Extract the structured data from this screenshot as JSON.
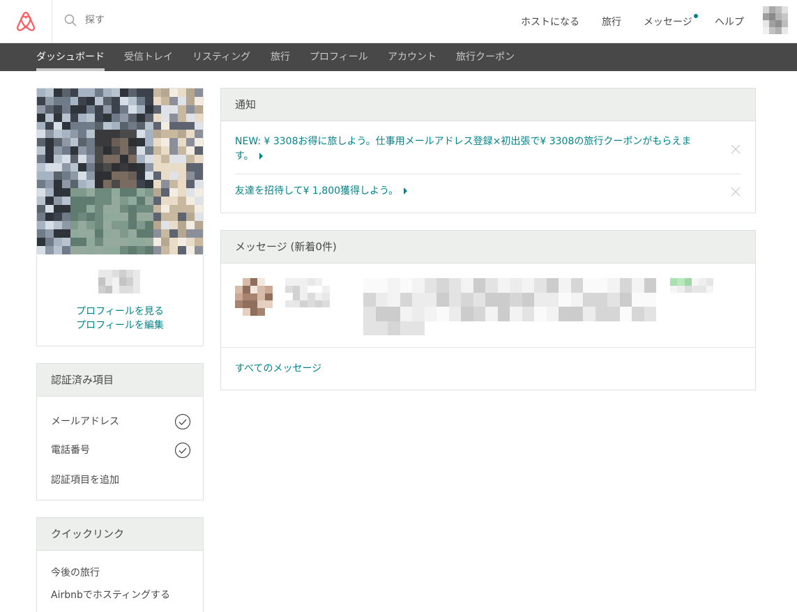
{
  "header": {
    "search_placeholder": "探す",
    "nav": {
      "host": "ホストになる",
      "trips": "旅行",
      "messages": "メッセージ",
      "help": "ヘルプ"
    }
  },
  "subnav": {
    "items": [
      "ダッシュボード",
      "受信トレイ",
      "リスティング",
      "旅行",
      "プロフィール",
      "アカウント",
      "旅行クーポン"
    ],
    "active": "ダッシュボード"
  },
  "profile": {
    "view_link": "プロフィールを見る",
    "edit_link": "プロフィールを編集"
  },
  "verified": {
    "title": "認証済み項目",
    "items": [
      "メールアドレス",
      "電話番号"
    ],
    "add_link": "認証項目を追加"
  },
  "quick_links": {
    "title": "クイックリンク",
    "items": [
      "今後の旅行",
      "Airbnbでホスティングする"
    ]
  },
  "notifications": {
    "title": "通知",
    "items": [
      {
        "line1": "NEW: ¥ 3308お得に旅しよう。仕事用メールアドレス登録×初出張で¥ 3308の旅行クーポンがもらえま",
        "line2": "す。"
      },
      {
        "line1": "友達を招待して¥ 1,800獲得しよう。",
        "line2": ""
      }
    ]
  },
  "messages": {
    "title": "メッセージ (新着0件)",
    "all_link": "すべてのメッセージ"
  },
  "colors": {
    "brand": "#FF5A5F",
    "link": "#008489",
    "subnav_bg": "#484848",
    "panel_header_bg": "#EDEFED"
  },
  "icons": {
    "logo": "airbnb-belo-logo",
    "search": "search-icon",
    "check": "check-circle-icon",
    "close": "close-icon",
    "arrow": "caret-right-icon"
  }
}
